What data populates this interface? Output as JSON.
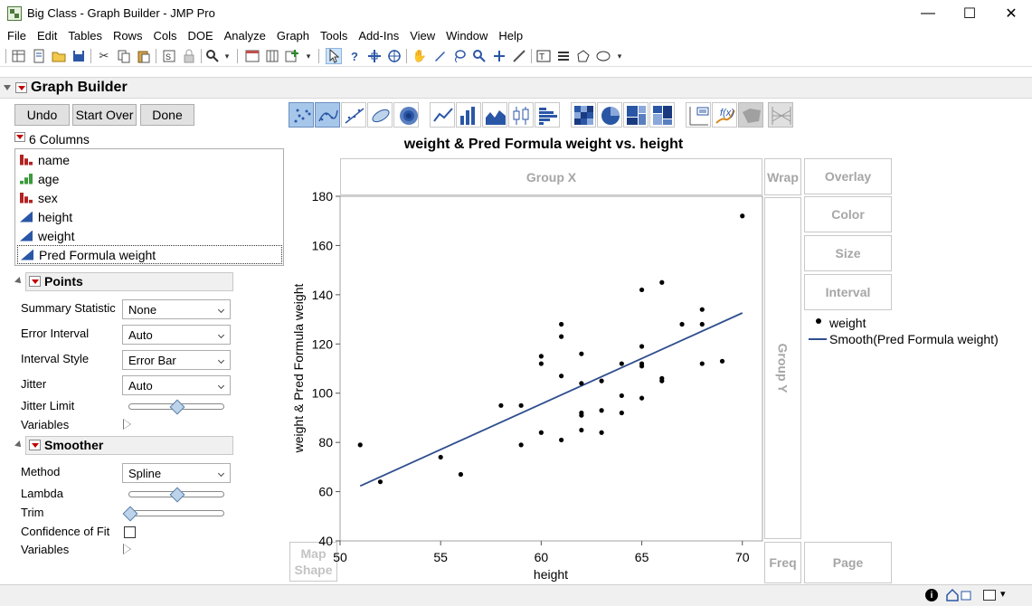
{
  "window": {
    "title": "Big Class - Graph Builder - JMP Pro",
    "minimize": "—",
    "maximize": "☐",
    "close": "✕"
  },
  "menu": [
    "File",
    "Edit",
    "Tables",
    "Rows",
    "Cols",
    "DOE",
    "Analyze",
    "Graph",
    "Tools",
    "Add-Ins",
    "View",
    "Window",
    "Help"
  ],
  "graph_builder": {
    "title": "Graph Builder",
    "buttons": {
      "undo": "Undo",
      "start_over": "Start Over",
      "done": "Done"
    },
    "columns_header": "6 Columns",
    "columns": [
      {
        "name": "name",
        "type": "nominal"
      },
      {
        "name": "age",
        "type": "ordinal"
      },
      {
        "name": "sex",
        "type": "nominal"
      },
      {
        "name": "height",
        "type": "continuous"
      },
      {
        "name": "weight",
        "type": "continuous"
      },
      {
        "name": "Pred Formula weight",
        "type": "continuous",
        "selected": true
      }
    ]
  },
  "points": {
    "title": "Points",
    "summary_statistic_label": "Summary Statistic",
    "summary_statistic": "None",
    "error_interval_label": "Error Interval",
    "error_interval": "Auto",
    "interval_style_label": "Interval Style",
    "interval_style": "Error Bar",
    "jitter_label": "Jitter",
    "jitter": "Auto",
    "jitter_limit_label": "Jitter Limit",
    "jitter_limit": 0.5,
    "variables_label": "Variables"
  },
  "smoother": {
    "title": "Smoother",
    "method_label": "Method",
    "method": "Spline",
    "lambda_label": "Lambda",
    "lambda": 0.5,
    "trim_label": "Trim",
    "trim": 0,
    "confidence_label": "Confidence of Fit",
    "confidence_checked": false,
    "variables_label": "Variables"
  },
  "zones": {
    "group_x": "Group X",
    "group_y": "Group Y",
    "wrap": "Wrap",
    "overlay": "Overlay",
    "color": "Color",
    "size": "Size",
    "interval": "Interval",
    "map_shape": "Map Shape",
    "freq": "Freq",
    "page": "Page"
  },
  "legend": {
    "points": "weight",
    "smooth": "Smooth(Pred Formula weight)"
  },
  "chart_data": {
    "type": "scatter",
    "title": "weight & Pred Formula weight vs. height",
    "xlabel": "height",
    "ylabel": "weight & Pred Formula weight",
    "xlim": [
      50,
      71
    ],
    "ylim": [
      40,
      180
    ],
    "xticks": [
      50,
      55,
      60,
      65,
      70
    ],
    "yticks": [
      40,
      60,
      80,
      100,
      120,
      140,
      160,
      180
    ],
    "grid": false,
    "legend_position": "right",
    "series": [
      {
        "name": "weight",
        "kind": "points",
        "color": "#000000",
        "points": [
          [
            51,
            79
          ],
          [
            52,
            64
          ],
          [
            55,
            74
          ],
          [
            56,
            67
          ],
          [
            58,
            95
          ],
          [
            59,
            79
          ],
          [
            59,
            95
          ],
          [
            60,
            84
          ],
          [
            60,
            112
          ],
          [
            60,
            115
          ],
          [
            61,
            81
          ],
          [
            61,
            107
          ],
          [
            61,
            123
          ],
          [
            61,
            128
          ],
          [
            62,
            85
          ],
          [
            62,
            91
          ],
          [
            62,
            92
          ],
          [
            62,
            104
          ],
          [
            62,
            116
          ],
          [
            63,
            84
          ],
          [
            63,
            93
          ],
          [
            63,
            105
          ],
          [
            64,
            92
          ],
          [
            64,
            99
          ],
          [
            64,
            112
          ],
          [
            65,
            98
          ],
          [
            65,
            111
          ],
          [
            65,
            112
          ],
          [
            65,
            119
          ],
          [
            65,
            142
          ],
          [
            66,
            105
          ],
          [
            66,
            106
          ],
          [
            66,
            145
          ],
          [
            67,
            128
          ],
          [
            68,
            112
          ],
          [
            68,
            128
          ],
          [
            68,
            134
          ],
          [
            69,
            113
          ],
          [
            70,
            172
          ]
        ]
      },
      {
        "name": "Smooth(Pred Formula weight)",
        "kind": "line",
        "color": "#2f4f8f",
        "points": [
          [
            51,
            62.3
          ],
          [
            70,
            132.6
          ]
        ]
      }
    ]
  }
}
